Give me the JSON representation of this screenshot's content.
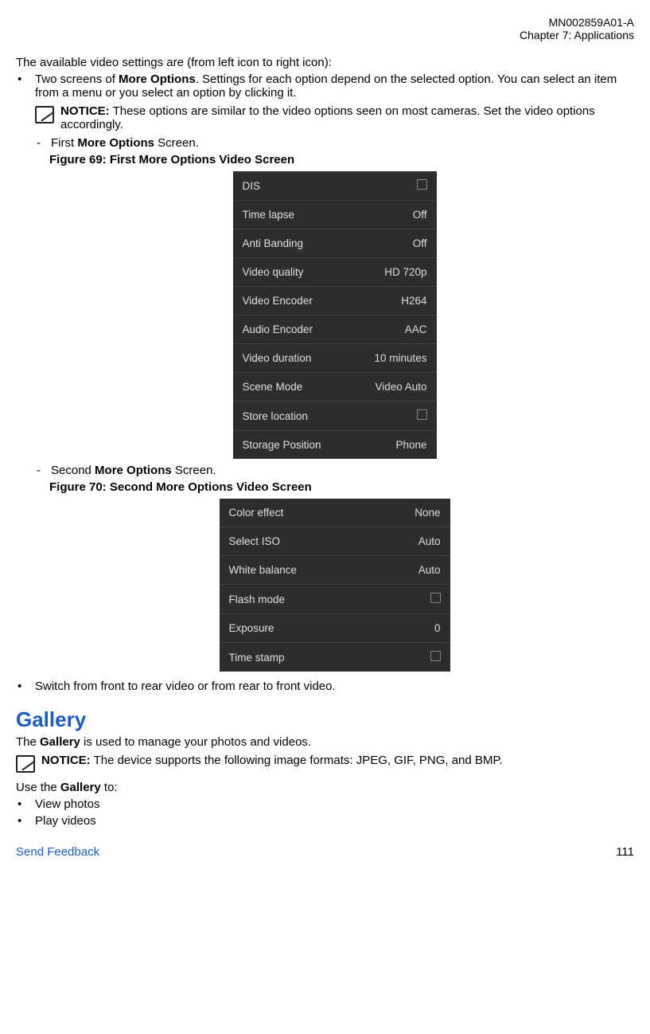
{
  "header": {
    "doc_id": "MN002859A01-A",
    "chapter": "Chapter 7:  Applications"
  },
  "intro": "The available video settings are (from left icon to right icon):",
  "bullet1": {
    "text_a": "Two screens of ",
    "bold_a": "More Options",
    "text_b": ". Settings for each option depend on the selected option. You can select an item from a menu or you select an option by clicking it."
  },
  "notice1": {
    "label": "NOTICE:",
    "text": " These options are similar to the video options seen on most cameras. Set the video options accordingly."
  },
  "dash1": {
    "a": "First ",
    "b": "More Options",
    "c": " Screen."
  },
  "fig69": "Figure 69: First More Options Video Screen",
  "screen1": [
    {
      "label": "DIS",
      "value": "",
      "checkbox": true
    },
    {
      "label": "Time lapse",
      "value": "Off"
    },
    {
      "label": "Anti Banding",
      "value": "Off"
    },
    {
      "label": "Video quality",
      "value": "HD 720p"
    },
    {
      "label": "Video Encoder",
      "value": "H264"
    },
    {
      "label": "Audio Encoder",
      "value": "AAC"
    },
    {
      "label": "Video duration",
      "value": "10 minutes"
    },
    {
      "label": "Scene Mode",
      "value": "Video Auto"
    },
    {
      "label": "Store location",
      "value": "",
      "checkbox": true
    },
    {
      "label": "Storage Position",
      "value": "Phone"
    }
  ],
  "dash2": {
    "a": "Second ",
    "b": "More Options",
    "c": " Screen."
  },
  "fig70": "Figure 70: Second More Options Video Screen",
  "screen2": [
    {
      "label": "Color effect",
      "value": "None"
    },
    {
      "label": "Select ISO",
      "value": "Auto"
    },
    {
      "label": "White balance",
      "value": "Auto"
    },
    {
      "label": "Flash mode",
      "value": "",
      "checkbox": true
    },
    {
      "label": "Exposure",
      "value": "0"
    },
    {
      "label": "Time stamp",
      "value": "",
      "checkbox": true
    }
  ],
  "bullet2": "Switch from front to rear video or from rear to front video.",
  "gallery": {
    "title": "Gallery",
    "line1_a": "The ",
    "line1_b": "Gallery",
    "line1_c": " is used to manage your photos and videos.",
    "notice_label": "NOTICE:",
    "notice_text": " The device supports the following image formats: JPEG, GIF, PNG, and BMP.",
    "use_a": "Use the ",
    "use_b": "Gallery",
    "use_c": " to:",
    "items": [
      "View photos",
      "Play videos"
    ]
  },
  "footer": {
    "feedback": "Send Feedback",
    "page": "111"
  }
}
